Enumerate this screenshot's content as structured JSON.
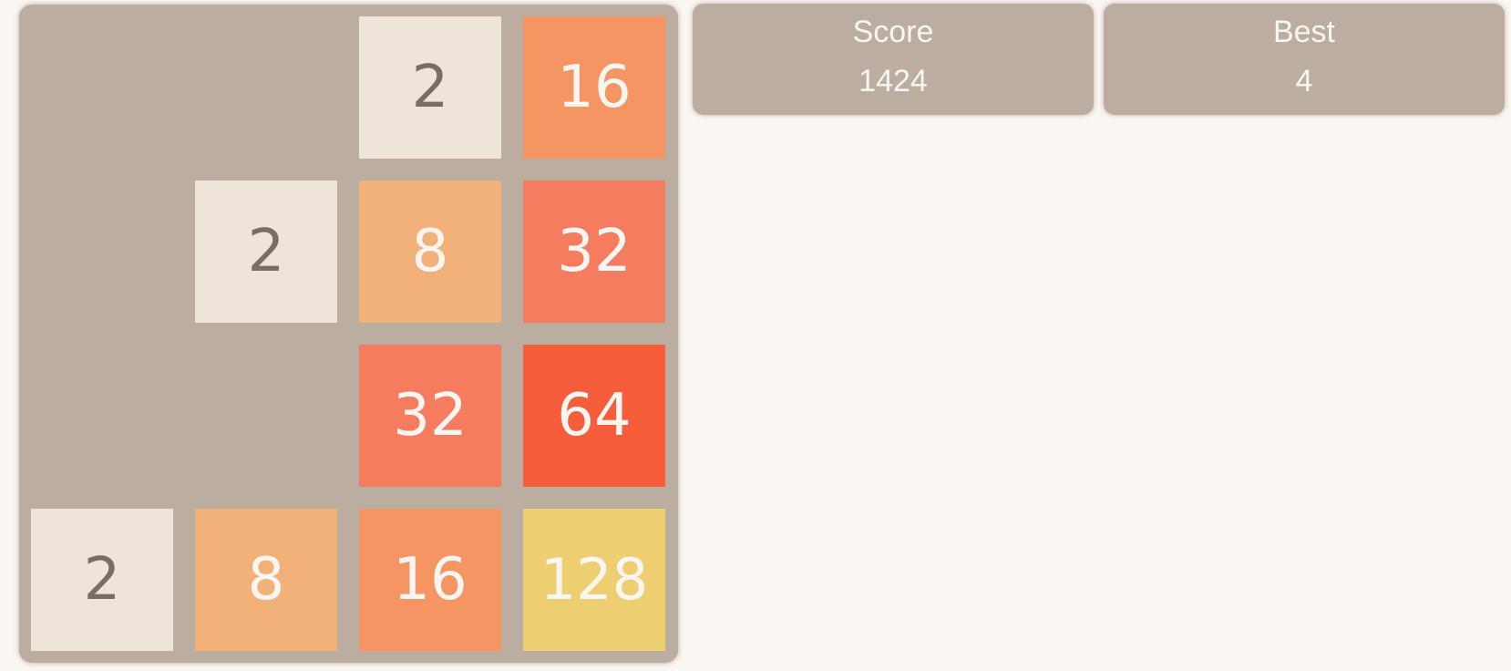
{
  "board": {
    "rows": [
      [
        0,
        0,
        2,
        16
      ],
      [
        0,
        2,
        8,
        32
      ],
      [
        0,
        0,
        32,
        64
      ],
      [
        2,
        8,
        16,
        128
      ]
    ]
  },
  "tile_colors": {
    "2": "#eee4da",
    "8": "#f2b179",
    "16": "#f59563",
    "32": "#f67c5f",
    "64": "#f65e3b",
    "128": "#edcf72",
    "board": "#bbada0",
    "background": "#faf6f1"
  },
  "score": {
    "label": "Score",
    "value": "1424"
  },
  "best": {
    "label": "Best",
    "value": "4"
  }
}
